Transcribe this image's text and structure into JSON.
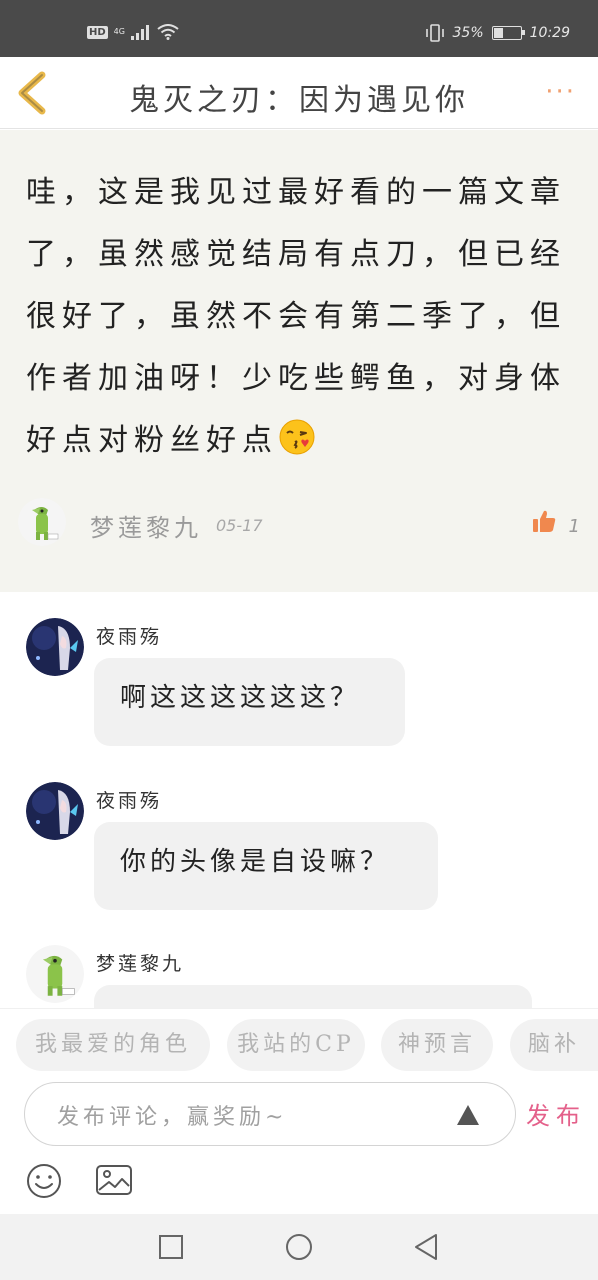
{
  "status_bar": {
    "hd": "HD",
    "network": "4G",
    "battery_percent": "35%",
    "battery_level": 0.35,
    "time": "10:29"
  },
  "header": {
    "title": "鬼灭之刃：因为遇见你",
    "back_icon": "chevron-left-icon",
    "more_icon": "more-dots-icon",
    "more_label": "···"
  },
  "main_comment": {
    "text": "哇，这是我见过最好看的一篇文章了，虽然感觉结局有点刀，但已经很好了，虽然不会有第二季了，但作者加油呀！少吃些鳄鱼，对身体好点对粉丝好点",
    "emoji": "kissing-heart-emoji",
    "author": "梦莲黎九",
    "date": "05-17",
    "like_count": "1"
  },
  "replies": [
    {
      "author": "夜雨殇",
      "text": "啊这这这这这这？"
    },
    {
      "author": "夜雨殇",
      "text": "你的头像是自设嘛？"
    },
    {
      "author": "梦莲黎九",
      "text": ""
    }
  ],
  "suggestions": [
    "我最爱的角色",
    "我站的CP",
    "神预言",
    "脑补"
  ],
  "input": {
    "placeholder": "发布评论，赢奖励~",
    "publish_label": "发布"
  },
  "colors": {
    "accent_orange": "#f0a070",
    "publish_pink": "#e4608a",
    "back_yellow": "#e8b84a",
    "comment_bg": "#f4f4ef"
  }
}
